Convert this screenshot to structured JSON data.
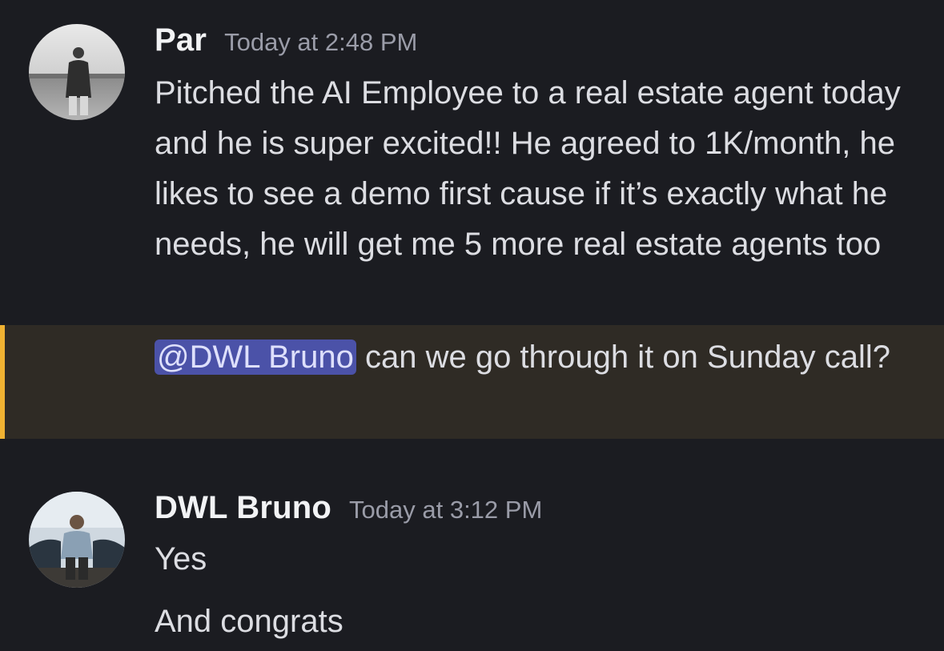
{
  "messages": [
    {
      "username": "Par",
      "timestamp": "Today at 2:48 PM",
      "text": "Pitched the AI Employee to a real estate agent today and he is super excited!! He agreed to 1K/month, he likes to see a demo first cause if it’s exactly what he needs, he will get me 5 more real estate agents too",
      "mention": {
        "label": "@DWL Bruno",
        "text": " can we go through it on Sunday call?"
      },
      "avatar_icon": "user-photo-avatar"
    },
    {
      "username": "DWL Bruno",
      "timestamp": "Today at 3:12 PM",
      "lines": [
        "Yes",
        "And congrats"
      ],
      "avatar_icon": "user-photo-avatar"
    }
  ],
  "colors": {
    "background": "#1b1c21",
    "mention_highlight_bg": "#2f2b25",
    "mention_bar": "#f0b232",
    "mention_chip": "#4b52a8"
  }
}
